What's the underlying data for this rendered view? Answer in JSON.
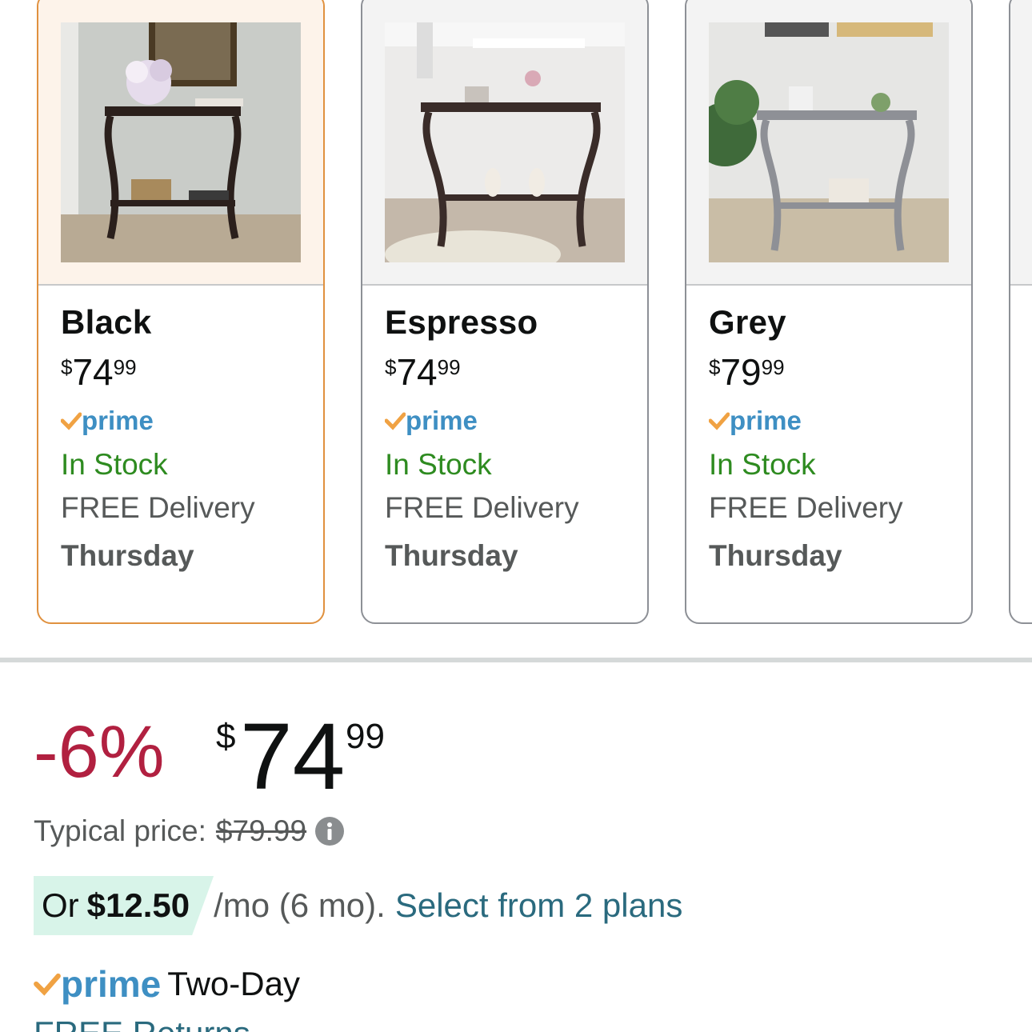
{
  "swatches": [
    {
      "color_name": "Black",
      "price_symbol": "$",
      "price_whole": "74",
      "price_fraction": "99",
      "prime_label": "prime",
      "stock": "In Stock",
      "delivery": "FREE Delivery",
      "delivery_day": "Thursday",
      "selected": true,
      "table_color": "#2b201c"
    },
    {
      "color_name": "Espresso",
      "price_symbol": "$",
      "price_whole": "74",
      "price_fraction": "99",
      "prime_label": "prime",
      "stock": "In Stock",
      "delivery": "FREE Delivery",
      "delivery_day": "Thursday",
      "selected": false,
      "table_color": "#3a2c29"
    },
    {
      "color_name": "Grey",
      "price_symbol": "$",
      "price_whole": "79",
      "price_fraction": "99",
      "prime_label": "prime",
      "stock": "In Stock",
      "delivery": "FREE Delivery",
      "delivery_day": "Thursday",
      "selected": false,
      "table_color": "#8e9096"
    }
  ],
  "price_block": {
    "discount": "-6%",
    "price_symbol": "$",
    "price_whole": "74",
    "price_fraction": "99",
    "typical_label": "Typical price:",
    "typical_price": "$79.99"
  },
  "installment": {
    "or_label": "Or",
    "amount": "$12.50",
    "term": "/mo (6 mo).",
    "link": "Select from 2 plans"
  },
  "prime_delivery": {
    "prime_label": "prime",
    "speed": "Two-Day"
  },
  "returns": {
    "label": "FREE Returns"
  },
  "colors": {
    "selected_border": "#e0913f",
    "discount": "#b12040",
    "in_stock": "#2e8b20",
    "prime_blue": "#3e8fc3",
    "prime_check": "#f0a243",
    "link": "#2a6a7e",
    "installment_bg": "#d8f4e9"
  },
  "icons": [
    "prime-check-icon",
    "info-icon"
  ]
}
